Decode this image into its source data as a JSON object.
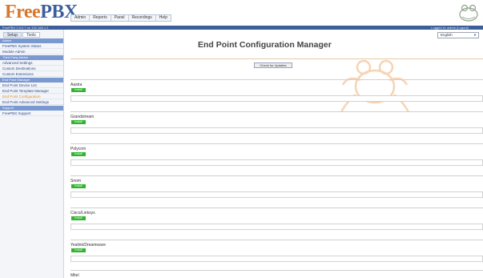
{
  "header": {
    "logo_part1": "Free",
    "logo_part2": "PBX",
    "tabs": [
      "Admin",
      "Reports",
      "Panel",
      "Recordings",
      "Help"
    ],
    "version": "FreePBX 2.9.0.7 on 192.168.1.2",
    "logged_in": "Logged in: admin (Logout)"
  },
  "language": {
    "selected": "English"
  },
  "sidebar": {
    "tabs": [
      "Setup",
      "Tools"
    ],
    "sections": [
      {
        "title": "Admin",
        "items": [
          {
            "label": "FreePBX System Status"
          },
          {
            "label": "Module Admin"
          }
        ]
      },
      {
        "title": "Third Party Addon",
        "items": [
          {
            "label": "Advanced Settings"
          },
          {
            "label": "Custom Destinations"
          },
          {
            "label": "Custom Extensions"
          }
        ]
      },
      {
        "title": "End Point Manager",
        "items": [
          {
            "label": "End Point Device List"
          },
          {
            "label": "End Point Template Manager"
          },
          {
            "label": "End Point Configuration"
          },
          {
            "label": "End Point Advanced Settings"
          }
        ]
      },
      {
        "title": "Support",
        "items": [
          {
            "label": "FreePBX Support"
          }
        ]
      }
    ]
  },
  "main": {
    "title": "End Point Configuration Manager",
    "check_updates": "Check for Updates",
    "brands": [
      {
        "name": "Aastra",
        "badge": "Install"
      },
      {
        "name": "Grandstream",
        "badge": "Install"
      },
      {
        "name": "Polycom",
        "badge": "Install"
      },
      {
        "name": "Snom",
        "badge": "Install"
      },
      {
        "name": "Cisco/Linksys",
        "badge": "Install"
      },
      {
        "name": "Yealink/Dreamwave",
        "badge": "Install"
      },
      {
        "name": "Mitel",
        "badge": ""
      }
    ]
  },
  "colors": {
    "accent_blue": "#3c5f9b",
    "logo_orange": "#d7772b",
    "install_green": "#2fb52f",
    "current_item_orange": "#e08a2e"
  }
}
